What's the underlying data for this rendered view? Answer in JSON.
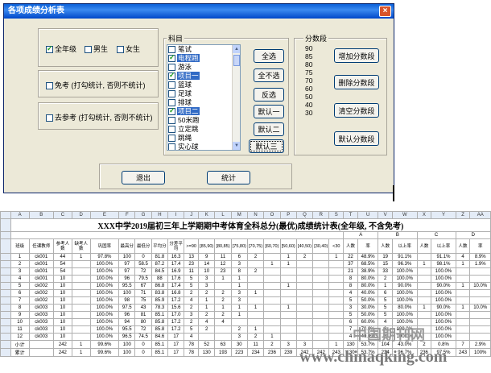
{
  "dialog": {
    "title": "各项成绩分析表",
    "close_glyph": "×",
    "checks": {
      "all": "全年级",
      "male": "男生",
      "female": "女生"
    },
    "exempt": "免考 (打勾统计, 否则不统计)",
    "retake": "去参考 (打勾统计, 否则不统计)",
    "subject_label": "科目",
    "subjects": [
      {
        "name": "笔试",
        "checked": false,
        "selected": false
      },
      {
        "name": "电程跑",
        "checked": true,
        "selected": true
      },
      {
        "name": "游泳",
        "checked": false,
        "selected": false
      },
      {
        "name": "项目一",
        "checked": true,
        "selected": true
      },
      {
        "name": "篮球",
        "checked": false,
        "selected": false
      },
      {
        "name": "足球",
        "checked": false,
        "selected": false
      },
      {
        "name": "排球",
        "checked": false,
        "selected": false
      },
      {
        "name": "项目二",
        "checked": true,
        "selected": true
      },
      {
        "name": "50米跑",
        "checked": false,
        "selected": false
      },
      {
        "name": "立定跳",
        "checked": false,
        "selected": false
      },
      {
        "name": "跳绳",
        "checked": false,
        "selected": false
      },
      {
        "name": "实心球",
        "checked": false,
        "selected": false
      }
    ],
    "btn_all": "全选",
    "btn_none": "全不选",
    "btn_invert": "反选",
    "btn_def1": "默认一",
    "btn_def2": "默认二",
    "btn_def3": "默认三",
    "seg_label": "分数段",
    "segments": [
      "90",
      "85",
      "80",
      "75",
      "70",
      "60",
      "50",
      "40",
      "30"
    ],
    "btn_add_seg": "增加分数段",
    "btn_del_seg": "删除分数段",
    "btn_clear_seg": "清空分数段",
    "btn_default_seg": "默认分数段",
    "btn_exit": "退出",
    "btn_stat": "统计"
  },
  "sheet": {
    "col_letters": [
      "A",
      "B",
      "C",
      "D",
      "E",
      "F",
      "G",
      "H",
      "I",
      "J",
      "K",
      "L",
      "M",
      "N",
      "O",
      "P",
      "Q",
      "R",
      "S",
      "T",
      "U",
      "V",
      "W",
      "X",
      "Y",
      "Z",
      "AA"
    ],
    "title": "XXX中学2019届初三年上学期期中考体育全科总分(最优)成绩统计表(全年级, 不含免考)",
    "headers": [
      "班级",
      "任课教师",
      "参考人数",
      "缺考人数",
      "巩固率",
      "最高分",
      "最低分",
      "平均分",
      "分差平均",
      ">=90",
      "[85,90)",
      "[80,85)",
      "[75,80)",
      "[70,75)",
      "[60,70)",
      "[50,60)",
      "[40,50)",
      "[30,40)",
      "<30",
      "人数",
      "率",
      "人数",
      "以上率",
      "人数",
      "以上率",
      "人数",
      "率"
    ],
    "groups": [
      "A",
      "B",
      "C",
      "D"
    ],
    "rows": [
      [
        "1",
        "ck001",
        "44",
        "1",
        "97.8%",
        "100",
        "0",
        "81.8",
        "16.3",
        "13",
        "9",
        "11",
        "6",
        "2",
        "",
        "1",
        "2",
        "",
        "1",
        "22",
        "48.9%",
        "19",
        "91.1%",
        "",
        "91.1%",
        "4",
        "8.9%"
      ],
      [
        "2",
        "ck001",
        "54",
        "",
        "100.0%",
        "97",
        "58.5",
        "87.2",
        "17.4",
        "23",
        "14",
        "12",
        "3",
        "",
        "1",
        "1",
        "",
        "",
        "",
        "37",
        "68.5%",
        "15",
        "96.3%",
        "1",
        "98.1%",
        "1",
        "1.9%"
      ],
      [
        "3",
        "ck001",
        "54",
        "",
        "100.0%",
        "97",
        "72",
        "84.5",
        "16.9",
        "11",
        "10",
        "23",
        "8",
        "2",
        "",
        "",
        "",
        "",
        "",
        "21",
        "38.9%",
        "33",
        "100.0%",
        "",
        "100.0%",
        "",
        ""
      ],
      [
        "4",
        "ck001",
        "10",
        "",
        "100.0%",
        "96",
        "79.5",
        "88",
        "17.6",
        "5",
        "3",
        "1",
        "1",
        "",
        "",
        "",
        "",
        "",
        "",
        "8",
        "80.0%",
        "2",
        "100.0%",
        "",
        "100.0%",
        "",
        ""
      ],
      [
        "5",
        "ck002",
        "10",
        "",
        "100.0%",
        "95.5",
        "67",
        "86.8",
        "17.4",
        "5",
        "3",
        "",
        "1",
        "",
        "",
        "1",
        "",
        "",
        "",
        "8",
        "80.0%",
        "1",
        "90.0%",
        "",
        "90.0%",
        "1",
        "10.0%"
      ],
      [
        "6",
        "ck002",
        "10",
        "",
        "100.0%",
        "100",
        "71",
        "83.8",
        "16.8",
        "2",
        "2",
        "2",
        "3",
        "1",
        "",
        "",
        "",
        "",
        "",
        "4",
        "40.0%",
        "6",
        "100.0%",
        "",
        "100.0%",
        "",
        ""
      ],
      [
        "7",
        "ck002",
        "10",
        "",
        "100.0%",
        "98",
        "75",
        "85.9",
        "17.2",
        "4",
        "1",
        "2",
        "3",
        "",
        "",
        "",
        "",
        "",
        "",
        "5",
        "50.0%",
        "5",
        "100.0%",
        "",
        "100.0%",
        "",
        ""
      ],
      [
        "8",
        "ck003",
        "10",
        "",
        "100.0%",
        "97.5",
        "43",
        "78.3",
        "15.6",
        "2",
        "1",
        "1",
        "1",
        "1",
        "",
        "1",
        "",
        "",
        "",
        "3",
        "30.0%",
        "5",
        "80.0%",
        "1",
        "90.0%",
        "1",
        "10.0%"
      ],
      [
        "9",
        "ck003",
        "10",
        "",
        "100.0%",
        "96",
        "81",
        "85.1",
        "17.0",
        "3",
        "2",
        "2",
        "1",
        "",
        "",
        "",
        "",
        "",
        "",
        "5",
        "50.0%",
        "5",
        "100.0%",
        "",
        "100.0%",
        "",
        ""
      ],
      [
        "10",
        "ck003",
        "10",
        "",
        "100.0%",
        "94",
        "80",
        "85.8",
        "17.2",
        "2",
        "4",
        "4",
        "",
        "",
        "",
        "",
        "",
        "",
        "",
        "6",
        "60.0%",
        "4",
        "100.0%",
        "",
        "100.0%",
        "",
        ""
      ],
      [
        "11",
        "ck003",
        "10",
        "",
        "100.0%",
        "95.5",
        "72",
        "85.8",
        "17.2",
        "5",
        "2",
        "",
        "2",
        "1",
        "",
        "",
        "",
        "",
        "",
        "7",
        "70.0%",
        "3",
        "100.0%",
        "",
        "100.0%",
        "",
        ""
      ],
      [
        "12",
        "ck003",
        "10",
        "",
        "100.0%",
        "96.5",
        "74.5",
        "84.6",
        "17",
        "4",
        "",
        "",
        "3",
        "2",
        "1",
        "",
        "",
        "",
        "",
        "4",
        "40.0%",
        "6",
        "100.0%",
        "",
        "100.0%",
        "",
        ""
      ],
      [
        "小计",
        "",
        "242",
        "1",
        "99.6%",
        "100",
        "0",
        "85.1",
        "17",
        "78",
        "52",
        "63",
        "30",
        "11",
        "2",
        "3",
        "3",
        "",
        "1",
        "130",
        "53.7%",
        "104",
        "43.0%",
        "2",
        "0.8%",
        "7",
        "2.9%"
      ],
      [
        "累计",
        "",
        "242",
        "1",
        "99.6%",
        "100",
        "0",
        "85.1",
        "17",
        "78",
        "130",
        "193",
        "223",
        "234",
        "236",
        "239",
        "242",
        "242",
        "243",
        "130",
        "53.7%",
        "234",
        "96.7%",
        "236",
        "97.5%",
        "243",
        "100%"
      ]
    ]
  },
  "watermark": {
    "cn": "中国期刊网",
    "url": "www.chinaqking.com"
  }
}
